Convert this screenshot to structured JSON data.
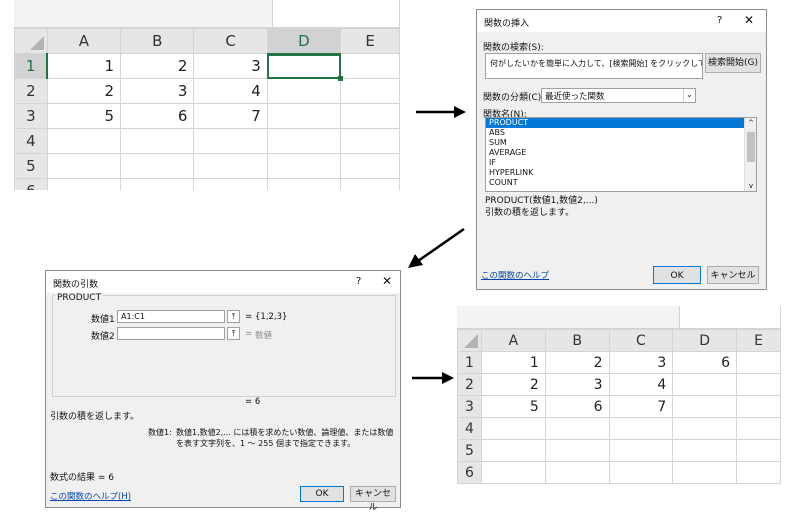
{
  "sheet1": {
    "columns": [
      "A",
      "B",
      "C",
      "D",
      "E"
    ],
    "rows": [
      {
        "num": "1",
        "cells": [
          "1",
          "2",
          "3",
          "",
          ""
        ]
      },
      {
        "num": "2",
        "cells": [
          "2",
          "3",
          "4",
          "",
          ""
        ]
      },
      {
        "num": "3",
        "cells": [
          "5",
          "6",
          "7",
          "",
          ""
        ]
      },
      {
        "num": "4",
        "cells": [
          "",
          "",
          "",
          "",
          ""
        ]
      },
      {
        "num": "5",
        "cells": [
          "",
          "",
          "",
          "",
          ""
        ]
      }
    ],
    "partial_row": "6"
  },
  "insert_function_dialog": {
    "title": "関数の挿入",
    "help_glyph": "?",
    "close_glyph": "✕",
    "search_label": "関数の検索(S):",
    "search_placeholder": "何がしたいかを簡単に入力して、[検索開始] をクリックしてください。",
    "search_button": "検索開始(G)",
    "category_label": "関数の分類(C):",
    "category_value": "最近使った関数",
    "name_label": "関数名(N):",
    "functions": [
      "PRODUCT",
      "ABS",
      "SUM",
      "AVERAGE",
      "IF",
      "HYPERLINK",
      "COUNT"
    ],
    "selected_function": "PRODUCT",
    "signature": "PRODUCT(数値1,数値2,...)",
    "description": "引数の積を返します。",
    "help_link": "この関数のヘルプ",
    "ok_button": "OK",
    "cancel_button": "キャンセル"
  },
  "function_arguments_dialog": {
    "title": "関数の引数",
    "help_glyph": "?",
    "close_glyph": "✕",
    "function_name": "PRODUCT",
    "args": [
      {
        "label": "数値1",
        "value": "A1:C1",
        "equals": "=",
        "result": "{1,2,3}"
      },
      {
        "label": "数値2",
        "value": "",
        "equals": "=",
        "result": "数値"
      }
    ],
    "formula_equals": "= 6",
    "description": "引数の積を返します。",
    "arg_help_label": "数値1:",
    "arg_help_text": "数値1,数値2,... には積を求めたい数値、論理値、または数値を表す文字列を、1 ～ 255 個まで指定できます。",
    "result_text": "数式の結果 =  6",
    "help_link": "この関数のヘルプ(H)",
    "ok_button": "OK",
    "cancel_button": "キャンセル"
  },
  "sheet2": {
    "columns": [
      "A",
      "B",
      "C",
      "D",
      "E"
    ],
    "rows": [
      {
        "num": "1",
        "cells": [
          "1",
          "2",
          "3",
          "6",
          ""
        ]
      },
      {
        "num": "2",
        "cells": [
          "2",
          "3",
          "4",
          "",
          ""
        ]
      },
      {
        "num": "3",
        "cells": [
          "5",
          "6",
          "7",
          "",
          ""
        ]
      },
      {
        "num": "4",
        "cells": [
          "",
          "",
          "",
          "",
          ""
        ]
      },
      {
        "num": "5",
        "cells": [
          "",
          "",
          "",
          "",
          ""
        ]
      },
      {
        "num": "6",
        "cells": [
          "",
          "",
          "",
          "",
          ""
        ]
      }
    ]
  },
  "colors": {
    "excel_green": "#217346",
    "selection_blue": "#0078d7",
    "arrow": "#000000"
  },
  "icons": [
    "right-arrow-icon",
    "down-left-arrow-icon",
    "help-icon",
    "close-icon",
    "dropdown-icon",
    "range-select-icon"
  ]
}
